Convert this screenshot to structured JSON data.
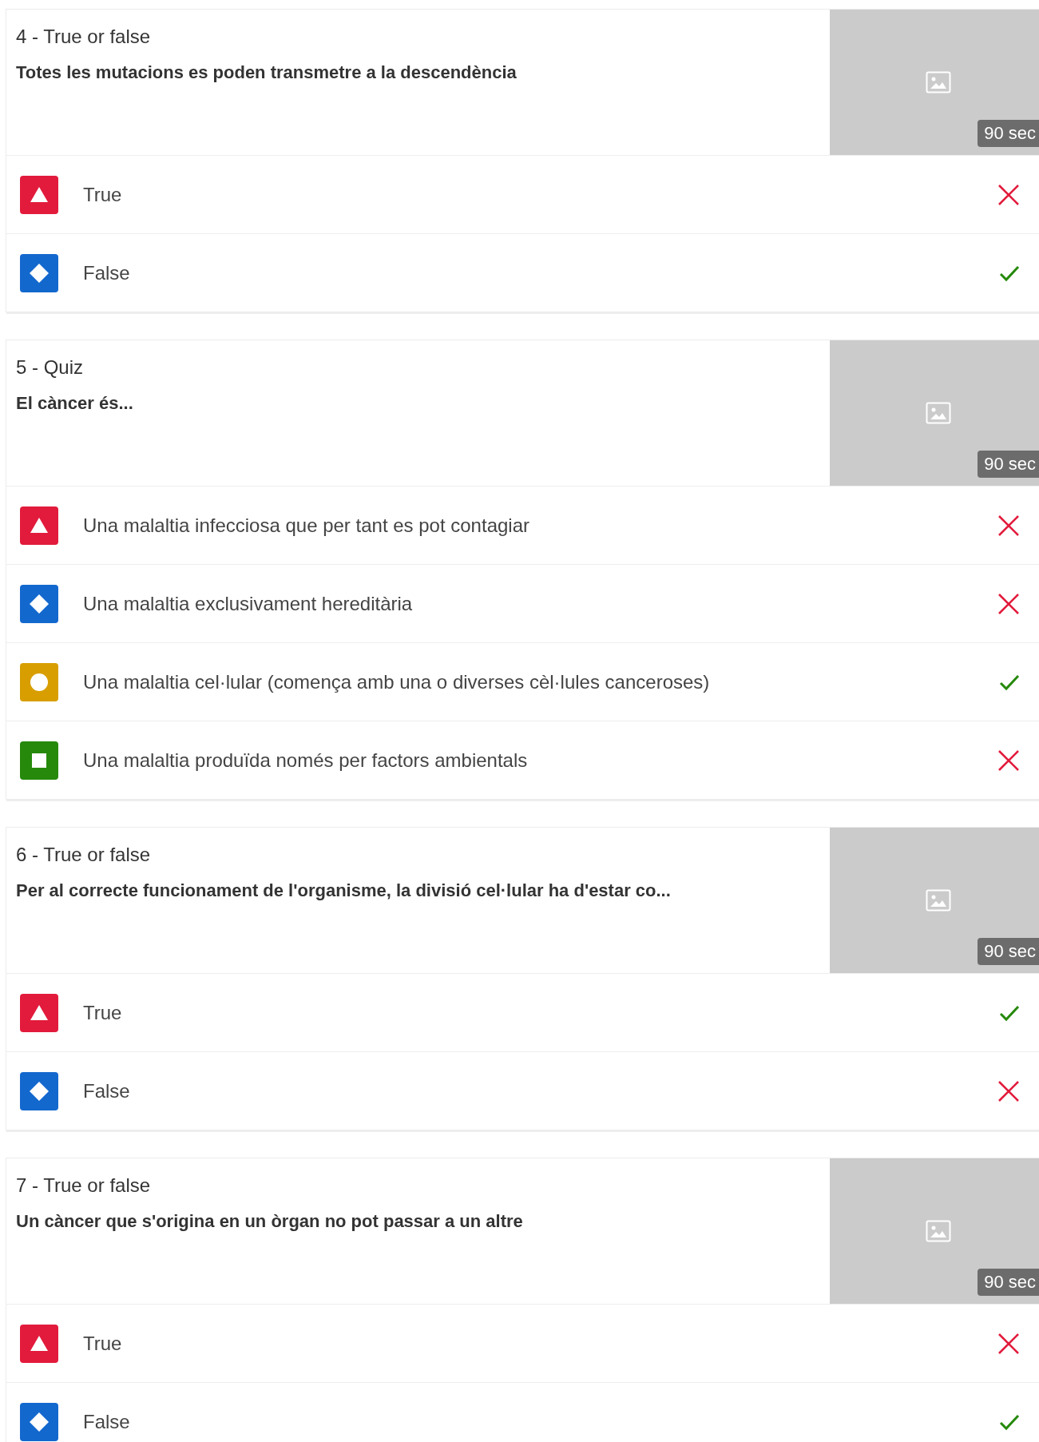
{
  "questions": [
    {
      "title": "4 - True or false",
      "question": "Totes les mutacions es poden transmetre a la descendència",
      "time": "90 sec",
      "answers": [
        {
          "kind": "triangle",
          "text": "True",
          "correct": false
        },
        {
          "kind": "diamond",
          "text": "False",
          "correct": true
        }
      ]
    },
    {
      "title": "5 - Quiz",
      "question": "El càncer és...",
      "time": "90 sec",
      "answers": [
        {
          "kind": "triangle",
          "text": "Una malaltia infecciosa que per tant es pot contagiar",
          "correct": false
        },
        {
          "kind": "diamond",
          "text": "Una malaltia exclusivament hereditària",
          "correct": false
        },
        {
          "kind": "circle",
          "text": "Una malaltia cel·lular (comença amb una o diverses cèl·lules canceroses)",
          "correct": true
        },
        {
          "kind": "square",
          "text": "Una malaltia produïda només per factors ambientals",
          "correct": false
        }
      ]
    },
    {
      "title": "6 - True or false",
      "question": "Per al correcte funcionament de l'organisme, la divisió cel·lular ha d'estar co...",
      "time": "90 sec",
      "answers": [
        {
          "kind": "triangle",
          "text": "True",
          "correct": true
        },
        {
          "kind": "diamond",
          "text": "False",
          "correct": false
        }
      ]
    },
    {
      "title": "7 - True or false",
      "question": "Un càncer que s'origina en un òrgan no pot passar a un altre",
      "time": "90 sec",
      "answers": [
        {
          "kind": "triangle",
          "text": "True",
          "correct": false
        },
        {
          "kind": "diamond",
          "text": "False",
          "correct": true
        }
      ]
    }
  ]
}
